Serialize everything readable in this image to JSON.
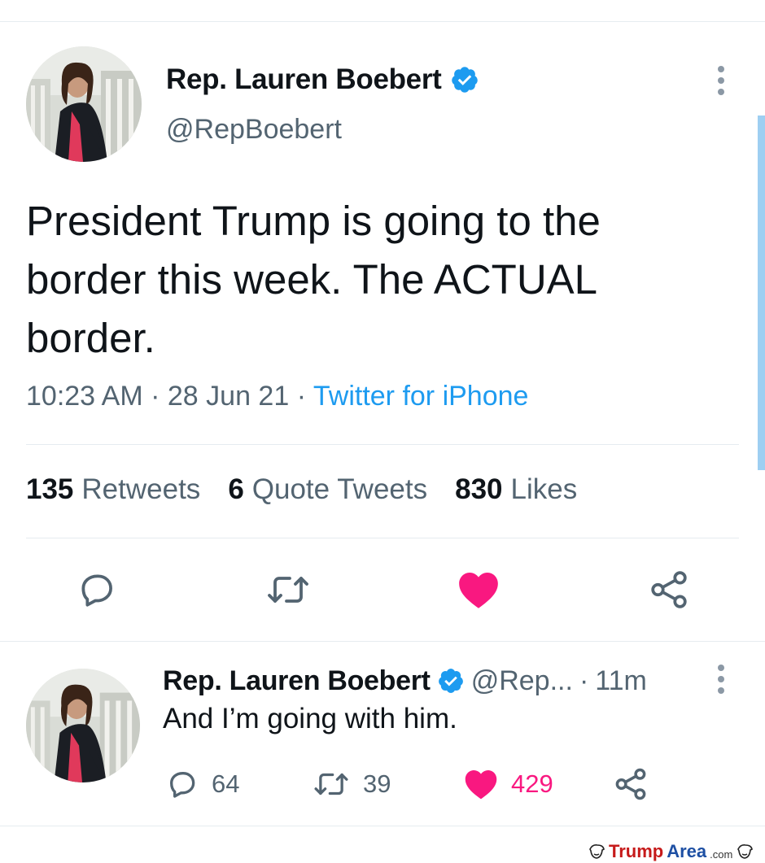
{
  "main_tweet": {
    "author_name": "Rep. Lauren Boebert",
    "handle": "@RepBoebert",
    "text": "President Trump is going to the border this week. The ACTUAL border.",
    "time": "10:23 AM",
    "date": "28 Jun 21",
    "separator": "·",
    "source": "Twitter for iPhone",
    "stats": {
      "retweets_count": "135",
      "retweets_label": "Retweets",
      "quotes_count": "6",
      "quotes_label": "Quote Tweets",
      "likes_count": "830",
      "likes_label": "Likes"
    },
    "actions": [
      "reply-icon",
      "retweet-icon",
      "like-icon",
      "share-icon"
    ]
  },
  "reply_tweet": {
    "author_name": "Rep. Lauren Boebert",
    "handle": "@Rep...",
    "separator": "·",
    "time": "11m",
    "text": "And I’m going with him.",
    "replies": "64",
    "retweets": "39",
    "likes": "429"
  },
  "watermark": {
    "part1": "Trump",
    "part2": "Area",
    "part3": ".com"
  },
  "colors": {
    "accent": "#1d9bf0",
    "like": "#f91880",
    "muted": "#536471",
    "text": "#0f1419",
    "divider": "#e6ecf0"
  }
}
